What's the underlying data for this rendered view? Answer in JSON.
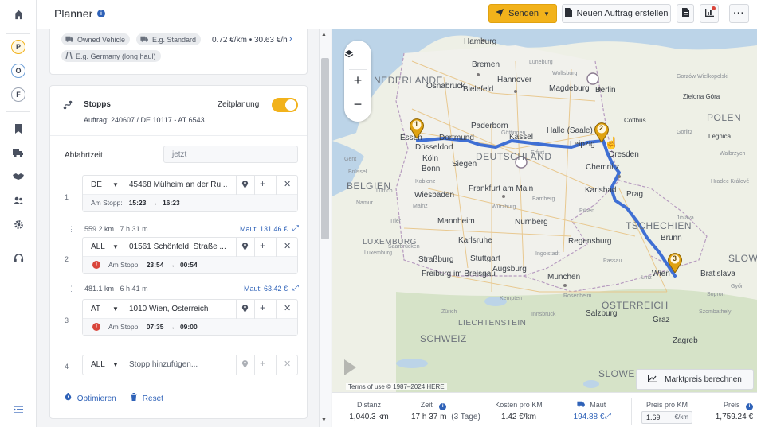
{
  "header": {
    "title": "Planner",
    "send_label": "Senden",
    "new_order_label": "Neuen Auftrag erstellen"
  },
  "rail": {
    "badges": [
      "P",
      "O",
      "F"
    ]
  },
  "vehicle": {
    "tag_vehicle": "Owned Vehicle",
    "tag_standard": "E.g. Standard",
    "tag_region": "E.g. Germany (long haul)",
    "cost": "0.72 €/km • 30.63 €/h"
  },
  "stopps": {
    "title": "Stopps",
    "subtitle": "Auftrag: 240607 / DE 10117 - AT 6543",
    "zeitplanung_label": "Zeitplanung",
    "abfahrtzeit_label": "Abfahrtzeit",
    "abfahrtzeit_value": "jetzt",
    "am_stopp_label": "Am Stopp:",
    "items": [
      {
        "num": "1",
        "country": "DE",
        "address": "45468 Mülheim an der Ru...",
        "arrive": "15:23",
        "depart": "16:23",
        "warn": false
      },
      {
        "num": "2",
        "country": "ALL",
        "address": "01561 Schönfeld, Straße ...",
        "arrive": "23:54",
        "depart": "00:54",
        "warn": true
      },
      {
        "num": "3",
        "country": "AT",
        "address": "1010 Wien, Österreich",
        "arrive": "07:35",
        "depart": "09:00",
        "warn": true
      },
      {
        "num": "4",
        "country": "ALL",
        "placeholder": "Stopp hinzufügen..."
      }
    ],
    "legs": [
      {
        "distance": "559.2 km",
        "duration": "7 h 31 m",
        "maut": "Maut: 131.46 €"
      },
      {
        "distance": "481.1 km",
        "duration": "6 h 41 m",
        "maut": "Maut: 63.42 €"
      }
    ],
    "optimize_label": "Optimieren",
    "reset_label": "Reset"
  },
  "map": {
    "countries": [
      "NEDERLANDE",
      "DEUTSCHLAND",
      "BELGIEN",
      "LUXEMBURG",
      "POLEN",
      "TSCHECHIEN",
      "ÖSTERREICH",
      "SCHWEIZ",
      "LIECHTENSTEIN",
      "SLOW",
      "SLOWE"
    ],
    "cities": [
      "Hamburg",
      "Bremen",
      "Berlin",
      "Hannover",
      "Bielefeld",
      "Magdeburg",
      "Osnabrück",
      "Dortmund",
      "Essen",
      "Düsseldorf",
      "Köln",
      "Bonn",
      "Siegen",
      "Kassel",
      "Göttingen",
      "Paderborn",
      "Halle (Saale)",
      "Leipzig",
      "Dresden",
      "Chemnitz",
      "Erfurt",
      "Frankfurt am Main",
      "Wiesbaden",
      "Mainz",
      "Mannheim",
      "Karlsruhe",
      "Stuttgart",
      "Nürnberg",
      "Regensburg",
      "Augsburg",
      "München",
      "Salzburg",
      "Linz",
      "Wien",
      "Bratislava",
      "Brünn",
      "Prag",
      "Pilsen",
      "Karlsbad",
      "Straßburg",
      "Freiburg im Breisgau",
      "Zürich",
      "Innsbruck",
      "Graz",
      "Zagreb",
      "Luxemburg",
      "Saarbrücken",
      "Cottbus",
      "Görlitz",
      "Lüneburg",
      "Wolfsburg",
      "Gorzów Wielkopolski",
      "Zielona Góra",
      "Legnica",
      "Wałbrzych",
      "Hradec Králové",
      "Jihlava",
      "Szombathely",
      "Sopron",
      "Győr",
      "Gent",
      "Brüssel",
      "Lüttich",
      "Namur",
      "Trier",
      "Koblenz",
      "Würzburg",
      "Ulm",
      "Ingolstadt",
      "Passau",
      "Bamberg",
      "Rosenheim",
      "Kempten"
    ],
    "copyright": "Terms of use   © 1987–2024 HERE",
    "pins": [
      "1",
      "2",
      "3"
    ]
  },
  "market_price_label": "Marktpreis berechnen",
  "stats": {
    "distanz_label": "Distanz",
    "distanz": "1,040.3 km",
    "zeit_label": "Zeit",
    "zeit": "17 h 37 m",
    "zeit_days": "(3 Tage)",
    "kosten_label": "Kosten pro KM",
    "kosten": "1.42 €/km",
    "maut_label": "Maut",
    "maut": "194.88 €",
    "preis_km_label": "Preis pro KM",
    "preis_km": "1.69",
    "preis_km_unit": "€/km",
    "preis_label": "Preis",
    "preis": "1,759.24 €"
  },
  "colors": {
    "accent": "#f2b21b",
    "link": "#2f62b8",
    "route": "#3f6fd4",
    "warn": "#d9453b"
  }
}
